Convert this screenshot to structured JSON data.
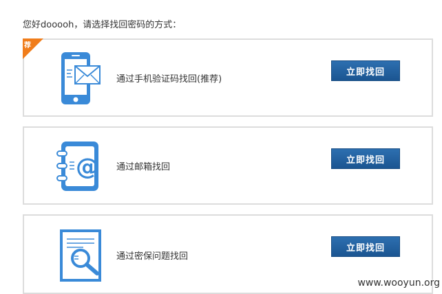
{
  "greeting": "您好dooooh，请选择找回密码的方式：",
  "methods": [
    {
      "label": "通过手机验证码找回(推荐)",
      "button": "立即找回",
      "badge": "荐"
    },
    {
      "label": "通过邮箱找回",
      "button": "立即找回"
    },
    {
      "label": "通过密保问题找回",
      "button": "立即找回"
    }
  ],
  "watermark": "www.wooyun.org",
  "colors": {
    "accent": "#3a8ad8",
    "button": "#1f5e9e",
    "badge": "#f07d1b",
    "border": "#dcdcdc"
  }
}
